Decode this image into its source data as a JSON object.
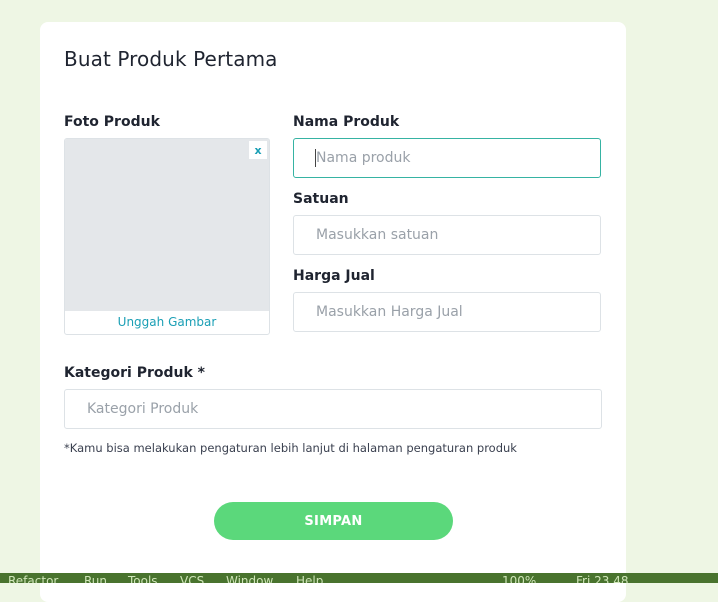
{
  "form": {
    "title": "Buat Produk Pertama",
    "photo": {
      "label": "Foto Produk",
      "close_symbol": "x",
      "upload_label": "Unggah Gambar"
    },
    "name": {
      "label": "Nama Produk",
      "placeholder": "Nama produk"
    },
    "unit": {
      "label": "Satuan",
      "placeholder": "Masukkan satuan"
    },
    "price": {
      "label": "Harga Jual",
      "placeholder": "Masukkan Harga Jual"
    },
    "category": {
      "label": "Kategori Produk *",
      "placeholder": "Kategori Produk"
    },
    "note": "*Kamu bisa melakukan pengaturan lebih lanjut di halaman pengaturan produk",
    "save_label": "SIMPAN"
  },
  "taskbar": {
    "items": [
      "Refactor",
      "Run",
      "Tools",
      "VCS",
      "Window",
      "Help"
    ],
    "battery": "100%",
    "clock": "Fri 23.48"
  },
  "colors": {
    "page_background": "#eef6e4",
    "accent_teal": "#1a9fb5",
    "focus_border": "#36b3a3",
    "save_button": "#5bd87b"
  }
}
